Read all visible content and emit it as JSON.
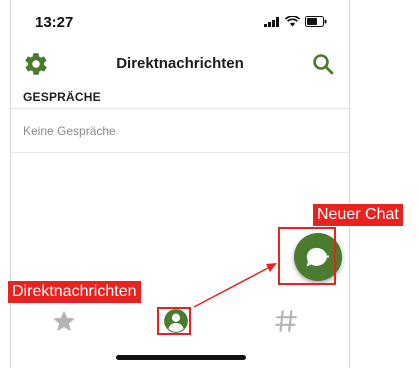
{
  "status_bar": {
    "time": "13:27"
  },
  "header": {
    "title": "Direktnachrichten",
    "left_icon": "gear-icon",
    "right_icon": "search-icon"
  },
  "section": {
    "title": "GESPRÄCHE",
    "empty_text": "Keine Gespräche"
  },
  "fab": {
    "icon": "new-chat-icon"
  },
  "tab_bar": {
    "items": [
      "star-icon",
      "person-icon",
      "hashtag-icon"
    ],
    "active": "person-icon"
  },
  "annotations": {
    "new_chat_label": "Neuer Chat",
    "direct_messages_label": "Direktnachrichten"
  },
  "colors": {
    "accent": "#4a7b2f",
    "annotation": "#e8231f",
    "inactive_icon": "#b3b3b3"
  }
}
